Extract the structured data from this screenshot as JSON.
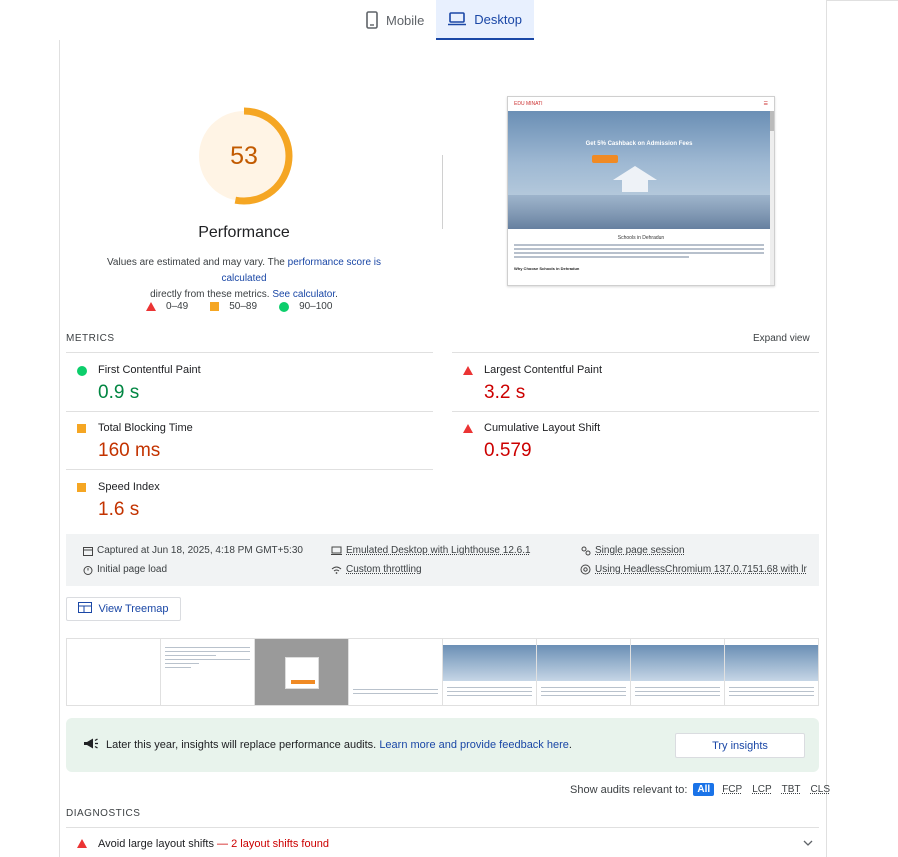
{
  "tabs": [
    {
      "label": "Mobile",
      "icon": "phone-icon",
      "active": false
    },
    {
      "label": "Desktop",
      "icon": "laptop-icon",
      "active": true
    }
  ],
  "score": {
    "value": "53",
    "fraction": 0.53,
    "color": "#f5a623",
    "label": "Performance"
  },
  "description": {
    "part1": "Values are estimated and may vary. The ",
    "link1": "performance score is calculated",
    "part2": " directly from these metrics. ",
    "link2": "See calculator",
    "part3": "."
  },
  "legend": [
    {
      "shape": "triangle",
      "label": "0–49",
      "color": "#eb3434"
    },
    {
      "shape": "square",
      "label": "50–89",
      "color": "#f5a623"
    },
    {
      "shape": "circle",
      "label": "90–100",
      "color": "#0cce6b"
    }
  ],
  "screenshot": {
    "brand": "EDU MINATI",
    "hero_text": "Get 5% Cashback on Admission Fees",
    "section_title": "Schools in Dehradun",
    "section_heading": "Why Choose Schools in Dehradun"
  },
  "metrics": {
    "heading": "METRICS",
    "expand_label": "Expand view",
    "items": [
      {
        "label": "First Contentful Paint",
        "value": "0.9 s",
        "rating": "good"
      },
      {
        "label": "Largest Contentful Paint",
        "value": "3.2 s",
        "rating": "bad"
      },
      {
        "label": "Total Blocking Time",
        "value": "160 ms",
        "rating": "avg"
      },
      {
        "label": "Cumulative Layout Shift",
        "value": "0.579",
        "rating": "bad"
      },
      {
        "label": "Speed Index",
        "value": "1.6 s",
        "rating": "avg"
      }
    ]
  },
  "runinfo": {
    "captured": "Captured at Jun 18, 2025, 4:18 PM GMT+5:30",
    "initial": "Initial page load",
    "device": "Emulated Desktop with Lighthouse 12.6.1",
    "throttling": "Custom throttling",
    "session": "Single page session",
    "browser": "Using HeadlessChromium 137.0.7151.68 with lr"
  },
  "treemap_label": "View Treemap",
  "banner": {
    "text": "Later this year, insights will replace performance audits. ",
    "link": "Learn more and provide feedback here",
    "text_end": ".",
    "button": "Try insights"
  },
  "filter": {
    "label": "Show audits relevant to:",
    "chips": [
      "All",
      "FCP",
      "LCP",
      "TBT",
      "CLS"
    ]
  },
  "diagnostics": {
    "heading": "DIAGNOSTICS",
    "audit_title": "Avoid large layout shifts",
    "audit_display": " — 2 layout shifts found"
  }
}
